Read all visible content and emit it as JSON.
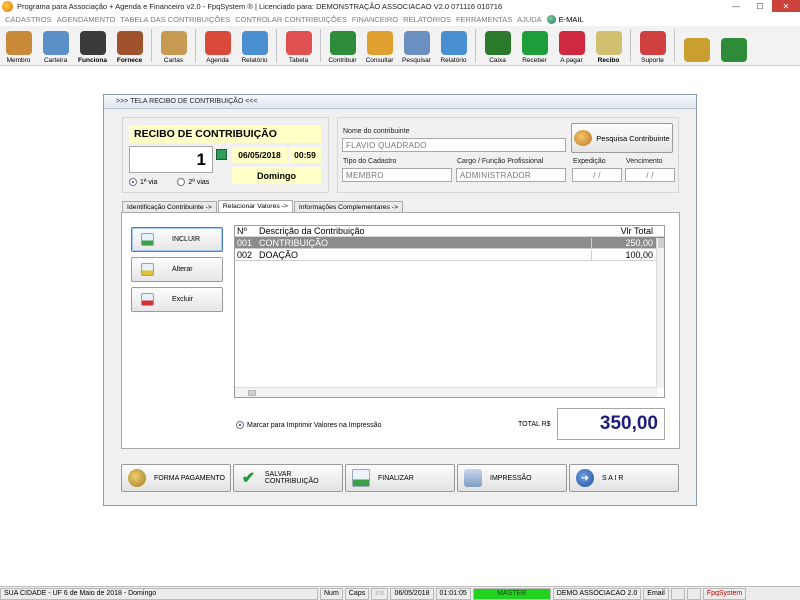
{
  "window": {
    "title": "Programa para Associação + Agenda e Financeiro v2.0 - FpqSystem ® | Licenciado para: DEMONSTRAÇÃO ASSOCIACAO V2.0 071116 010716",
    "minimize": "—",
    "maximize": "☐",
    "close": "✕"
  },
  "menu": [
    "CADASTROS",
    "AGENDAMENTO",
    "TABELA DAS CONTRIBUIÇÕES",
    "CONTROLAR CONTRIBUIÇÕES",
    "FINANCEIRO",
    "RELATÓRIOS",
    "FERRAMENTAS",
    "AJUDA"
  ],
  "menu_email": "E-MAIL",
  "toolbar": [
    {
      "label": "Membro",
      "icon": "people-icon",
      "color": "#c98a3a",
      "bold": false
    },
    {
      "label": "Carteira",
      "icon": "id-card-icon",
      "color": "#5b8fc8",
      "bold": false
    },
    {
      "label": "Funciona",
      "icon": "worker-icon",
      "color": "#3a3a3a",
      "bold": true
    },
    {
      "label": "Fornece",
      "icon": "supplier-icon",
      "color": "#a0522d",
      "bold": true
    },
    {
      "label": "Cartas",
      "icon": "scroll-icon",
      "color": "#c79a54",
      "bold": false
    },
    {
      "label": "Agenda",
      "icon": "calendar-icon",
      "color": "#d94a3a",
      "bold": false
    },
    {
      "label": "Relatório",
      "icon": "report-icon",
      "color": "#4a8fd0",
      "bold": false
    },
    {
      "label": "Tabela",
      "icon": "table-icon",
      "color": "#e05050",
      "bold": false
    },
    {
      "label": "Contribuir",
      "icon": "money-icon",
      "color": "#2e8b3a",
      "bold": false
    },
    {
      "label": "Consultar",
      "icon": "folder-icon",
      "color": "#e0a030",
      "bold": false
    },
    {
      "label": "Pesquisar",
      "icon": "search-doc-icon",
      "color": "#6a90c0",
      "bold": false
    },
    {
      "label": "Relatório",
      "icon": "report2-icon",
      "color": "#4a8fd0",
      "bold": false
    },
    {
      "label": "Caixa",
      "icon": "cash-icon",
      "color": "#2b7a2b",
      "bold": false
    },
    {
      "label": "Receber",
      "icon": "receive-icon",
      "color": "#1e9e3a",
      "bold": false
    },
    {
      "label": "A pagar",
      "icon": "pay-icon",
      "color": "#d02840",
      "bold": false
    },
    {
      "label": "Recibo",
      "icon": "receipt-icon",
      "color": "#d0c070",
      "bold": true
    },
    {
      "label": "Suporte",
      "icon": "support-icon",
      "color": "#d04040",
      "bold": false
    },
    {
      "label": "",
      "icon": "coins-icon",
      "color": "#c9a030",
      "bold": false
    },
    {
      "label": "",
      "icon": "exit-icon",
      "color": "#2e8b3a",
      "bold": false
    }
  ],
  "dialog": {
    "title": ">>>   TELA RECIBO DE CONTRIBUIÇÃO    <<<",
    "receipt_title": "RECIBO DE CONTRIBUIÇÃO",
    "number": "1",
    "date": "06/05/2018",
    "time": "00:59",
    "weekday": "Domingo",
    "via1": "1ª via",
    "via2": "2ª vias",
    "labels": {
      "contribuinte": "Nome do contribuinte",
      "tipo": "Tipo do Cadastro",
      "cargo": "Cargo / Função Profissional",
      "expedicao": "Expedição",
      "vencimento": "Vencimento"
    },
    "values": {
      "contribuinte": "FLAVIO QUADRADO",
      "tipo": "MEMBRO",
      "cargo": "ADMINISTRADOR",
      "expedicao": "/ /",
      "vencimento": "/ /"
    },
    "search_button": "Pesquisa Contribuinte",
    "tabs": [
      "Identificação Contribuinte ->",
      "Relacionar Valores ->",
      "Informações Complementares ->"
    ],
    "side_buttons": {
      "incluir": "INCLUIR",
      "alterar": "Alterar",
      "excluir": "Excluir"
    },
    "grid": {
      "headers": [
        "Nº",
        "Descrição da Contribuição",
        "Vlr Total"
      ],
      "rows": [
        [
          "001",
          "CONTRIBUIÇÃO",
          "250,00"
        ],
        [
          "002",
          "DOAÇÃO",
          "100,00"
        ]
      ]
    },
    "print_option": "Marcar para Imprimir Valores na Impressão",
    "total_label": "TOTAL R$",
    "total_value": "350,00",
    "bottom_buttons": {
      "forma": "FORMA PAGAMENTO",
      "salvar": "SALVAR CONTRIBUIÇÃO",
      "finalizar": "FINALIZAR",
      "impressao": "IMPRESSÃO",
      "sair": "S A I R"
    }
  },
  "status": {
    "location": "SUA CIDADE - UF  6 de Maio de 2018 - Domingo",
    "num": "Num",
    "caps": "Caps",
    "ins": "Ins",
    "date": "06/05/2018",
    "time": "01:01:05",
    "user": "MASTER",
    "license": "DEMO ASSOCIACAO 2.0",
    "email": "Email",
    "brand": "FpqSystem"
  }
}
